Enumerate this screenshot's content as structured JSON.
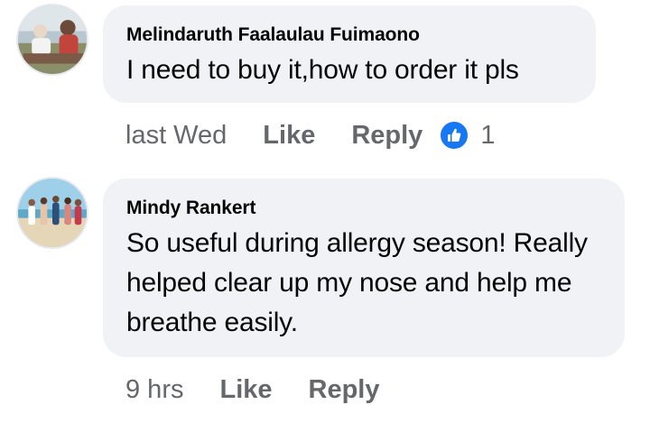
{
  "comments": [
    {
      "author": "Melindaruth Faalaulau Fuimaono",
      "text": "I need to buy it,how to order it pls",
      "time": "last Wed",
      "like_label": "Like",
      "reply_label": "Reply",
      "reaction_count": "1",
      "reaction_icon": "thumbs-up-icon",
      "avatar_icon": "avatar-photo"
    },
    {
      "author": "Mindy Rankert",
      "text": "So useful during allergy season! Really helped clear up my nose and help me breathe easily.",
      "time": "9 hrs",
      "like_label": "Like",
      "reply_label": "Reply",
      "avatar_icon": "avatar-photo"
    }
  ],
  "colors": {
    "bubble": "#f0f2f5",
    "text": "#050505",
    "meta": "#65676b",
    "like_blue": "#1877f2"
  }
}
